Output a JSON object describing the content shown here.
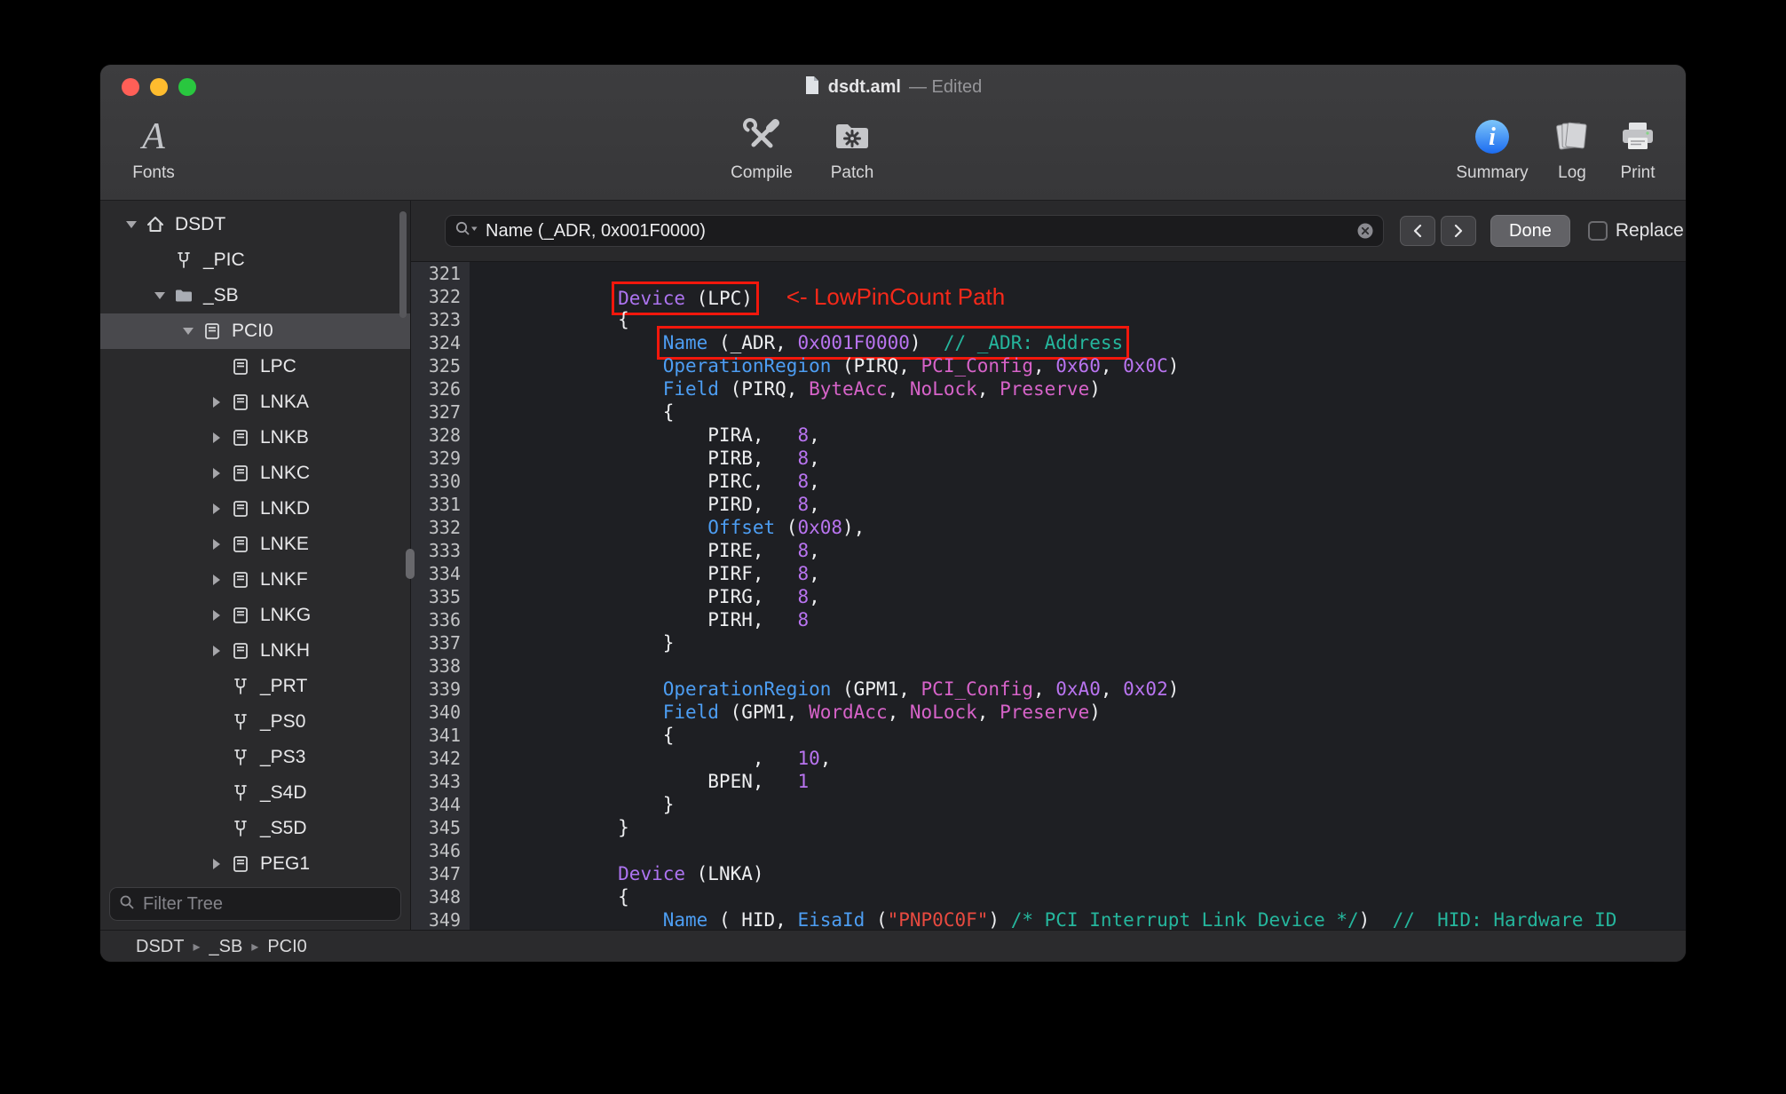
{
  "window": {
    "title_filename": "dsdt.aml",
    "title_status": "— Edited"
  },
  "toolbar": {
    "fonts_label": "Fonts",
    "compile_label": "Compile",
    "patch_label": "Patch",
    "summary_label": "Summary",
    "log_label": "Log",
    "print_label": "Print"
  },
  "icons": {
    "fonts": "serif-A",
    "compile": "crossed-wrench-screwdriver",
    "patch": "folder-with-gear",
    "summary": "info-circle-i",
    "log": "stacked-pages",
    "print": "printer",
    "document_proxy": "document-page",
    "search": "magnifier-with-scope-chevron",
    "clear": "circle-x",
    "filter": "magnifier",
    "tree_house": "house",
    "tree_method": "fork",
    "tree_folder": "folder",
    "tree_device": "card-with-lines"
  },
  "sidebar": {
    "filter_placeholder": "Filter Tree",
    "items": [
      {
        "label": "DSDT",
        "level": 0,
        "icon": "house",
        "disclosure": "down",
        "selected": false
      },
      {
        "label": "_PIC",
        "level": 1,
        "icon": "method",
        "disclosure": "none",
        "selected": false
      },
      {
        "label": "_SB",
        "level": 1,
        "icon": "folder",
        "disclosure": "down",
        "selected": false
      },
      {
        "label": "PCI0",
        "level": 2,
        "icon": "device",
        "disclosure": "down",
        "selected": true
      },
      {
        "label": "LPC",
        "level": 3,
        "icon": "device",
        "disclosure": "none",
        "selected": false
      },
      {
        "label": "LNKA",
        "level": 3,
        "icon": "device",
        "disclosure": "right",
        "selected": false
      },
      {
        "label": "LNKB",
        "level": 3,
        "icon": "device",
        "disclosure": "right",
        "selected": false
      },
      {
        "label": "LNKC",
        "level": 3,
        "icon": "device",
        "disclosure": "right",
        "selected": false
      },
      {
        "label": "LNKD",
        "level": 3,
        "icon": "device",
        "disclosure": "right",
        "selected": false
      },
      {
        "label": "LNKE",
        "level": 3,
        "icon": "device",
        "disclosure": "right",
        "selected": false
      },
      {
        "label": "LNKF",
        "level": 3,
        "icon": "device",
        "disclosure": "right",
        "selected": false
      },
      {
        "label": "LNKG",
        "level": 3,
        "icon": "device",
        "disclosure": "right",
        "selected": false
      },
      {
        "label": "LNKH",
        "level": 3,
        "icon": "device",
        "disclosure": "right",
        "selected": false
      },
      {
        "label": "_PRT",
        "level": 3,
        "icon": "method",
        "disclosure": "none",
        "selected": false
      },
      {
        "label": "_PS0",
        "level": 3,
        "icon": "method",
        "disclosure": "none",
        "selected": false
      },
      {
        "label": "_PS3",
        "level": 3,
        "icon": "method",
        "disclosure": "none",
        "selected": false
      },
      {
        "label": "_S4D",
        "level": 3,
        "icon": "method",
        "disclosure": "none",
        "selected": false
      },
      {
        "label": "_S5D",
        "level": 3,
        "icon": "method",
        "disclosure": "none",
        "selected": false
      },
      {
        "label": "PEG1",
        "level": 3,
        "icon": "device",
        "disclosure": "right",
        "selected": false
      }
    ]
  },
  "findbar": {
    "query": "Name (_ADR, 0x001F0000)",
    "done_label": "Done",
    "replace_label": "Replace"
  },
  "statusbar": {
    "breadcrumb": [
      "DSDT",
      "_SB",
      "PCI0"
    ]
  },
  "editor": {
    "annotation_color": "#f5291a",
    "lines": [
      {
        "n": 321,
        "g": []
      },
      {
        "n": 322,
        "g": [
          {
            "s": [
              {
                "t": "        ",
                "c": "p"
              }
            ]
          },
          {
            "box": true,
            "s": [
              {
                "t": "Device",
                "c": "dev"
              },
              {
                "t": " (LPC)",
                "c": "p"
              }
            ]
          },
          {
            "s": [
              {
                "t": "   ",
                "c": "p"
              },
              {
                "t": "<- LowPinCount Path",
                "c": "ann"
              }
            ]
          }
        ]
      },
      {
        "n": 323,
        "g": [
          {
            "s": [
              {
                "t": "        {",
                "c": "p"
              }
            ]
          }
        ]
      },
      {
        "n": 324,
        "g": [
          {
            "s": [
              {
                "t": "            ",
                "c": "p"
              }
            ]
          },
          {
            "box": true,
            "s": [
              {
                "t": "Name",
                "c": "kw"
              },
              {
                "t": " (_ADR, ",
                "c": "p"
              },
              {
                "t": "0x001F0000",
                "c": "num"
              },
              {
                "t": ")",
                "c": "p"
              },
              {
                "t": "  ",
                "c": "p"
              },
              {
                "t": "// _ADR: Address",
                "c": "com"
              }
            ]
          }
        ]
      },
      {
        "n": 325,
        "g": [
          {
            "s": [
              {
                "t": "            ",
                "c": "p"
              },
              {
                "t": "OperationRegion",
                "c": "kw"
              },
              {
                "t": " (PIRQ, ",
                "c": "p"
              },
              {
                "t": "PCI_Config",
                "c": "type"
              },
              {
                "t": ", ",
                "c": "p"
              },
              {
                "t": "0x60",
                "c": "num"
              },
              {
                "t": ", ",
                "c": "p"
              },
              {
                "t": "0x0C",
                "c": "num"
              },
              {
                "t": ")",
                "c": "p"
              }
            ]
          }
        ]
      },
      {
        "n": 326,
        "g": [
          {
            "s": [
              {
                "t": "            ",
                "c": "p"
              },
              {
                "t": "Field",
                "c": "kw"
              },
              {
                "t": " (PIRQ, ",
                "c": "p"
              },
              {
                "t": "ByteAcc",
                "c": "type"
              },
              {
                "t": ", ",
                "c": "p"
              },
              {
                "t": "NoLock",
                "c": "type"
              },
              {
                "t": ", ",
                "c": "p"
              },
              {
                "t": "Preserve",
                "c": "type"
              },
              {
                "t": ")",
                "c": "p"
              }
            ]
          }
        ]
      },
      {
        "n": 327,
        "g": [
          {
            "s": [
              {
                "t": "            {",
                "c": "p"
              }
            ]
          }
        ]
      },
      {
        "n": 328,
        "g": [
          {
            "s": [
              {
                "t": "                PIRA,   ",
                "c": "p"
              },
              {
                "t": "8",
                "c": "num"
              },
              {
                "t": ",",
                "c": "p"
              }
            ]
          }
        ]
      },
      {
        "n": 329,
        "g": [
          {
            "s": [
              {
                "t": "                PIRB,   ",
                "c": "p"
              },
              {
                "t": "8",
                "c": "num"
              },
              {
                "t": ",",
                "c": "p"
              }
            ]
          }
        ]
      },
      {
        "n": 330,
        "g": [
          {
            "s": [
              {
                "t": "                PIRC,   ",
                "c": "p"
              },
              {
                "t": "8",
                "c": "num"
              },
              {
                "t": ",",
                "c": "p"
              }
            ]
          }
        ]
      },
      {
        "n": 331,
        "g": [
          {
            "s": [
              {
                "t": "                PIRD,   ",
                "c": "p"
              },
              {
                "t": "8",
                "c": "num"
              },
              {
                "t": ",",
                "c": "p"
              }
            ]
          }
        ]
      },
      {
        "n": 332,
        "g": [
          {
            "s": [
              {
                "t": "                ",
                "c": "p"
              },
              {
                "t": "Offset",
                "c": "kw"
              },
              {
                "t": " (",
                "c": "p"
              },
              {
                "t": "0x08",
                "c": "num"
              },
              {
                "t": "),",
                "c": "p"
              }
            ]
          }
        ]
      },
      {
        "n": 333,
        "g": [
          {
            "s": [
              {
                "t": "                PIRE,   ",
                "c": "p"
              },
              {
                "t": "8",
                "c": "num"
              },
              {
                "t": ",",
                "c": "p"
              }
            ]
          }
        ]
      },
      {
        "n": 334,
        "g": [
          {
            "s": [
              {
                "t": "                PIRF,   ",
                "c": "p"
              },
              {
                "t": "8",
                "c": "num"
              },
              {
                "t": ",",
                "c": "p"
              }
            ]
          }
        ]
      },
      {
        "n": 335,
        "g": [
          {
            "s": [
              {
                "t": "                PIRG,   ",
                "c": "p"
              },
              {
                "t": "8",
                "c": "num"
              },
              {
                "t": ",",
                "c": "p"
              }
            ]
          }
        ]
      },
      {
        "n": 336,
        "g": [
          {
            "s": [
              {
                "t": "                PIRH,   ",
                "c": "p"
              },
              {
                "t": "8",
                "c": "num"
              }
            ]
          }
        ]
      },
      {
        "n": 337,
        "g": [
          {
            "s": [
              {
                "t": "            }",
                "c": "p"
              }
            ]
          }
        ]
      },
      {
        "n": 338,
        "g": []
      },
      {
        "n": 339,
        "g": [
          {
            "s": [
              {
                "t": "            ",
                "c": "p"
              },
              {
                "t": "OperationRegion",
                "c": "kw"
              },
              {
                "t": " (GPM1, ",
                "c": "p"
              },
              {
                "t": "PCI_Config",
                "c": "type"
              },
              {
                "t": ", ",
                "c": "p"
              },
              {
                "t": "0xA0",
                "c": "num"
              },
              {
                "t": ", ",
                "c": "p"
              },
              {
                "t": "0x02",
                "c": "num"
              },
              {
                "t": ")",
                "c": "p"
              }
            ]
          }
        ]
      },
      {
        "n": 340,
        "g": [
          {
            "s": [
              {
                "t": "            ",
                "c": "p"
              },
              {
                "t": "Field",
                "c": "kw"
              },
              {
                "t": " (GPM1, ",
                "c": "p"
              },
              {
                "t": "WordAcc",
                "c": "type"
              },
              {
                "t": ", ",
                "c": "p"
              },
              {
                "t": "NoLock",
                "c": "type"
              },
              {
                "t": ", ",
                "c": "p"
              },
              {
                "t": "Preserve",
                "c": "type"
              },
              {
                "t": ")",
                "c": "p"
              }
            ]
          }
        ]
      },
      {
        "n": 341,
        "g": [
          {
            "s": [
              {
                "t": "            {",
                "c": "p"
              }
            ]
          }
        ]
      },
      {
        "n": 342,
        "g": [
          {
            "s": [
              {
                "t": "                    ,   ",
                "c": "p"
              },
              {
                "t": "10",
                "c": "num"
              },
              {
                "t": ",",
                "c": "p"
              }
            ]
          }
        ]
      },
      {
        "n": 343,
        "g": [
          {
            "s": [
              {
                "t": "                BPEN,   ",
                "c": "p"
              },
              {
                "t": "1",
                "c": "num"
              }
            ]
          }
        ]
      },
      {
        "n": 344,
        "g": [
          {
            "s": [
              {
                "t": "            }",
                "c": "p"
              }
            ]
          }
        ]
      },
      {
        "n": 345,
        "g": [
          {
            "s": [
              {
                "t": "        }",
                "c": "p"
              }
            ]
          }
        ]
      },
      {
        "n": 346,
        "g": []
      },
      {
        "n": 347,
        "g": [
          {
            "s": [
              {
                "t": "        ",
                "c": "p"
              },
              {
                "t": "Device",
                "c": "dev"
              },
              {
                "t": " (LNKA)",
                "c": "p"
              }
            ]
          }
        ]
      },
      {
        "n": 348,
        "g": [
          {
            "s": [
              {
                "t": "        {",
                "c": "p"
              }
            ]
          }
        ]
      },
      {
        "n": 349,
        "g": [
          {
            "s": [
              {
                "t": "            ",
                "c": "p"
              },
              {
                "t": "Name",
                "c": "kw"
              },
              {
                "t": " (_HID, ",
                "c": "p"
              },
              {
                "t": "EisaId",
                "c": "kw"
              },
              {
                "t": " (",
                "c": "p"
              },
              {
                "t": "\"PNP0C0F\"",
                "c": "str"
              },
              {
                "t": ") ",
                "c": "p"
              },
              {
                "t": "/* PCI Interrupt Link Device */",
                "c": "com"
              },
              {
                "t": ")  ",
                "c": "p"
              },
              {
                "t": "// _HID: Hardware ID",
                "c": "com"
              }
            ]
          }
        ]
      }
    ]
  }
}
